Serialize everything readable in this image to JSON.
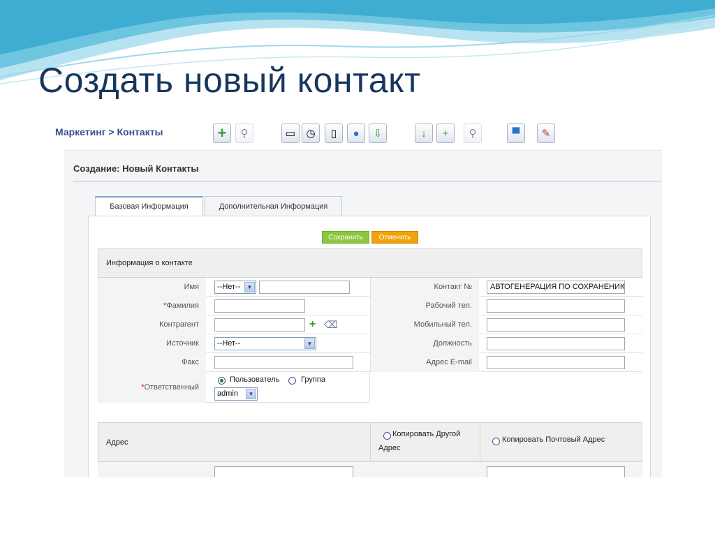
{
  "slide": {
    "title": "Создать новый контакт"
  },
  "colors": {
    "title": "#17375e",
    "wave": "#4fb8d8",
    "save_button": "#8cc63f",
    "cancel_button": "#f0a30a",
    "breadcrumb": "#3b4f8c"
  },
  "breadcrumb": {
    "module": "Маркетинг",
    "separator": ">",
    "page": "Контакты"
  },
  "toolbar": {
    "icons": [
      "plus-icon",
      "search-icon",
      "calendar-icon",
      "clock-icon",
      "phone-icon",
      "chat-icon",
      "clipboard-icon",
      "import-icon",
      "export-icon",
      "find-duplicates-icon",
      "monitor-icon",
      "settings-icon"
    ]
  },
  "page": {
    "heading": "Создание: Новый Контакты"
  },
  "tabs": [
    {
      "label": "Базовая Информация",
      "active": true
    },
    {
      "label": "Дополнительная Информация",
      "active": false
    }
  ],
  "actions": {
    "save": "Сохранить",
    "cancel": "Отменить"
  },
  "contact_section": {
    "title": "Информация о контакте",
    "fields": {
      "first_name": {
        "label": "Имя",
        "salutation": "--Нет--",
        "value": ""
      },
      "last_name": {
        "label": "Фамилия",
        "required_mark": "*",
        "value": ""
      },
      "account": {
        "label": "Контрагент",
        "value": ""
      },
      "source": {
        "label": "Источник",
        "value": "--Нет--"
      },
      "fax": {
        "label": "Факс",
        "value": ""
      },
      "assigned": {
        "label": "Ответственный",
        "required_mark": "*",
        "user_option": "Пользователь",
        "group_option": "Группа",
        "selected": "Пользователь",
        "user_value": "admin"
      },
      "contact_no": {
        "label": "Контакт №",
        "value": "АВТОГЕНЕРАЦИЯ ПО СОХРАНЕНИЮ"
      },
      "work_phone": {
        "label": "Рабочий тел.",
        "value": ""
      },
      "mobile_phone": {
        "label": "Мобильный тел.",
        "value": ""
      },
      "position": {
        "label": "Должность",
        "value": ""
      },
      "email": {
        "label": "Адрес E-mail",
        "value": ""
      }
    }
  },
  "address_section": {
    "title": "Адрес",
    "copy_other_line1": "Копировать Другой",
    "copy_other_line2": "Адрес",
    "copy_mailing": "Копировать Почтовый Адрес"
  }
}
